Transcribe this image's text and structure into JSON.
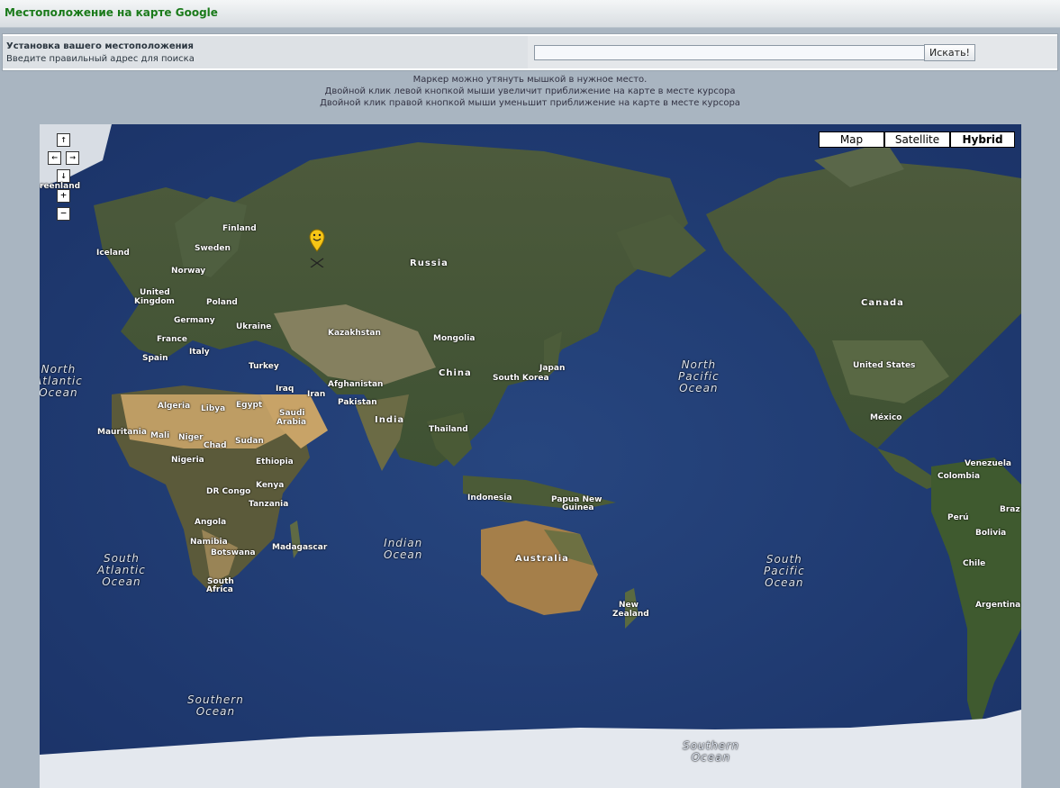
{
  "header": {
    "title": "Местоположение на карте Google"
  },
  "location": {
    "title": "Установка вашего местоположения",
    "hint": "Введите правильный адрес для поиска",
    "input_value": "",
    "search_label": "Искать!"
  },
  "instructions": [
    "Маркер можно утянуть мышкой в нужное место.",
    "Двойной клик левой кнопкой мыши увеличит приближение на карте в месте курсора",
    "Двойной клик правой кнопкой мыши уменьшит приближение на карте в месте курсора"
  ],
  "map": {
    "types": [
      {
        "label": "Map",
        "active": false
      },
      {
        "label": "Satellite",
        "active": false
      },
      {
        "label": "Hybrid",
        "active": true
      }
    ],
    "nav_icons": [
      "arrow-up-icon",
      "arrow-left-icon",
      "arrow-right-icon",
      "arrow-down-icon",
      "zoom-in-icon",
      "zoom-out-icon"
    ],
    "labels": {
      "greenland": "reenland",
      "iceland": "Iceland",
      "finland": "Finland",
      "sweden": "Sweden",
      "norway": "Norway",
      "united_kingdom_1": "United",
      "united_kingdom_2": "Kingdom",
      "poland": "Poland",
      "germany": "Germany",
      "ukraine": "Ukraine",
      "france": "France",
      "italy": "Italy",
      "spain": "Spain",
      "turkey": "Turkey",
      "russia": "Russia",
      "kazakhstan": "Kazakhstan",
      "mongolia": "Mongolia",
      "china": "China",
      "japan": "Japan",
      "south_korea": "South Korea",
      "iraq": "Iraq",
      "iran": "Iran",
      "afghanistan": "Afghanistan",
      "pakistan": "Pakistan",
      "india": "India",
      "thailand": "Thailand",
      "algeria": "Algeria",
      "libya": "Libya",
      "egypt": "Egypt",
      "saudi_1": "Saudi",
      "saudi_2": "Arabia",
      "mauritania": "Mauritania",
      "mali": "Mali",
      "niger": "Niger",
      "chad": "Chad",
      "sudan": "Sudan",
      "nigeria": "Nigeria",
      "ethiopia": "Ethiopia",
      "dr_congo": "DR Congo",
      "kenya": "Kenya",
      "tanzania": "Tanzania",
      "angola": "Angola",
      "namibia": "Namibia",
      "botswana": "Botswana",
      "madagascar": "Madagascar",
      "south_africa_1": "South",
      "south_africa_2": "Africa",
      "indonesia": "Indonesia",
      "papua_1": "Papua New",
      "papua_2": "Guinea",
      "australia": "Australia",
      "new_zealand_1": "New",
      "new_zealand_2": "Zealand",
      "canada": "Canada",
      "united_states": "United States",
      "mexico": "México",
      "venezuela": "Venezuela",
      "colombia": "Colombia",
      "peru": "Perú",
      "brazil": "Braz",
      "bolivia": "Bolivia",
      "chile": "Chile",
      "argentina": "Argentina"
    },
    "oceans": {
      "north_atlantic": [
        "North",
        "Atlantic",
        "Ocean"
      ],
      "north_pacific": [
        "North",
        "Pacific",
        "Ocean"
      ],
      "indian": [
        "Indian",
        "Ocean"
      ],
      "south_atlantic": [
        "South",
        "Atlantic",
        "Ocean"
      ],
      "south_pacific": [
        "South",
        "Pacific",
        "Ocean"
      ],
      "southern_1": [
        "Southern",
        "Ocean"
      ],
      "southern_2": [
        "Southern",
        "Ocean"
      ]
    }
  }
}
